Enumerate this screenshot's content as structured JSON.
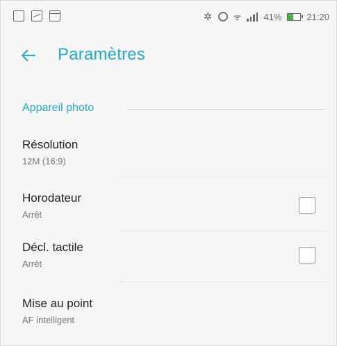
{
  "status_bar": {
    "battery_percent_text": "41%",
    "battery_level": 0.41,
    "time": "21:20",
    "bluetooth_glyph": "✲",
    "wifi_glyph": "ᯤ"
  },
  "app_bar": {
    "back_icon": "arrow-left",
    "title": "Paramètres"
  },
  "category": {
    "title": "Appareil photo"
  },
  "preferences": [
    {
      "title": "Résolution",
      "summary": "12M (16:9)",
      "has_checkbox": false
    },
    {
      "title": "Horodateur",
      "summary": "Arrêt",
      "has_checkbox": true,
      "checked": false
    },
    {
      "title": "Décl. tactile",
      "summary": "Arrêt",
      "has_checkbox": true,
      "checked": false
    },
    {
      "title": "Mise au point",
      "summary": "AF intelligent",
      "has_checkbox": false
    }
  ],
  "colors": {
    "accent": "#26a9c9",
    "background": "#f6f6f6",
    "battery_fill": "#4caf50"
  }
}
